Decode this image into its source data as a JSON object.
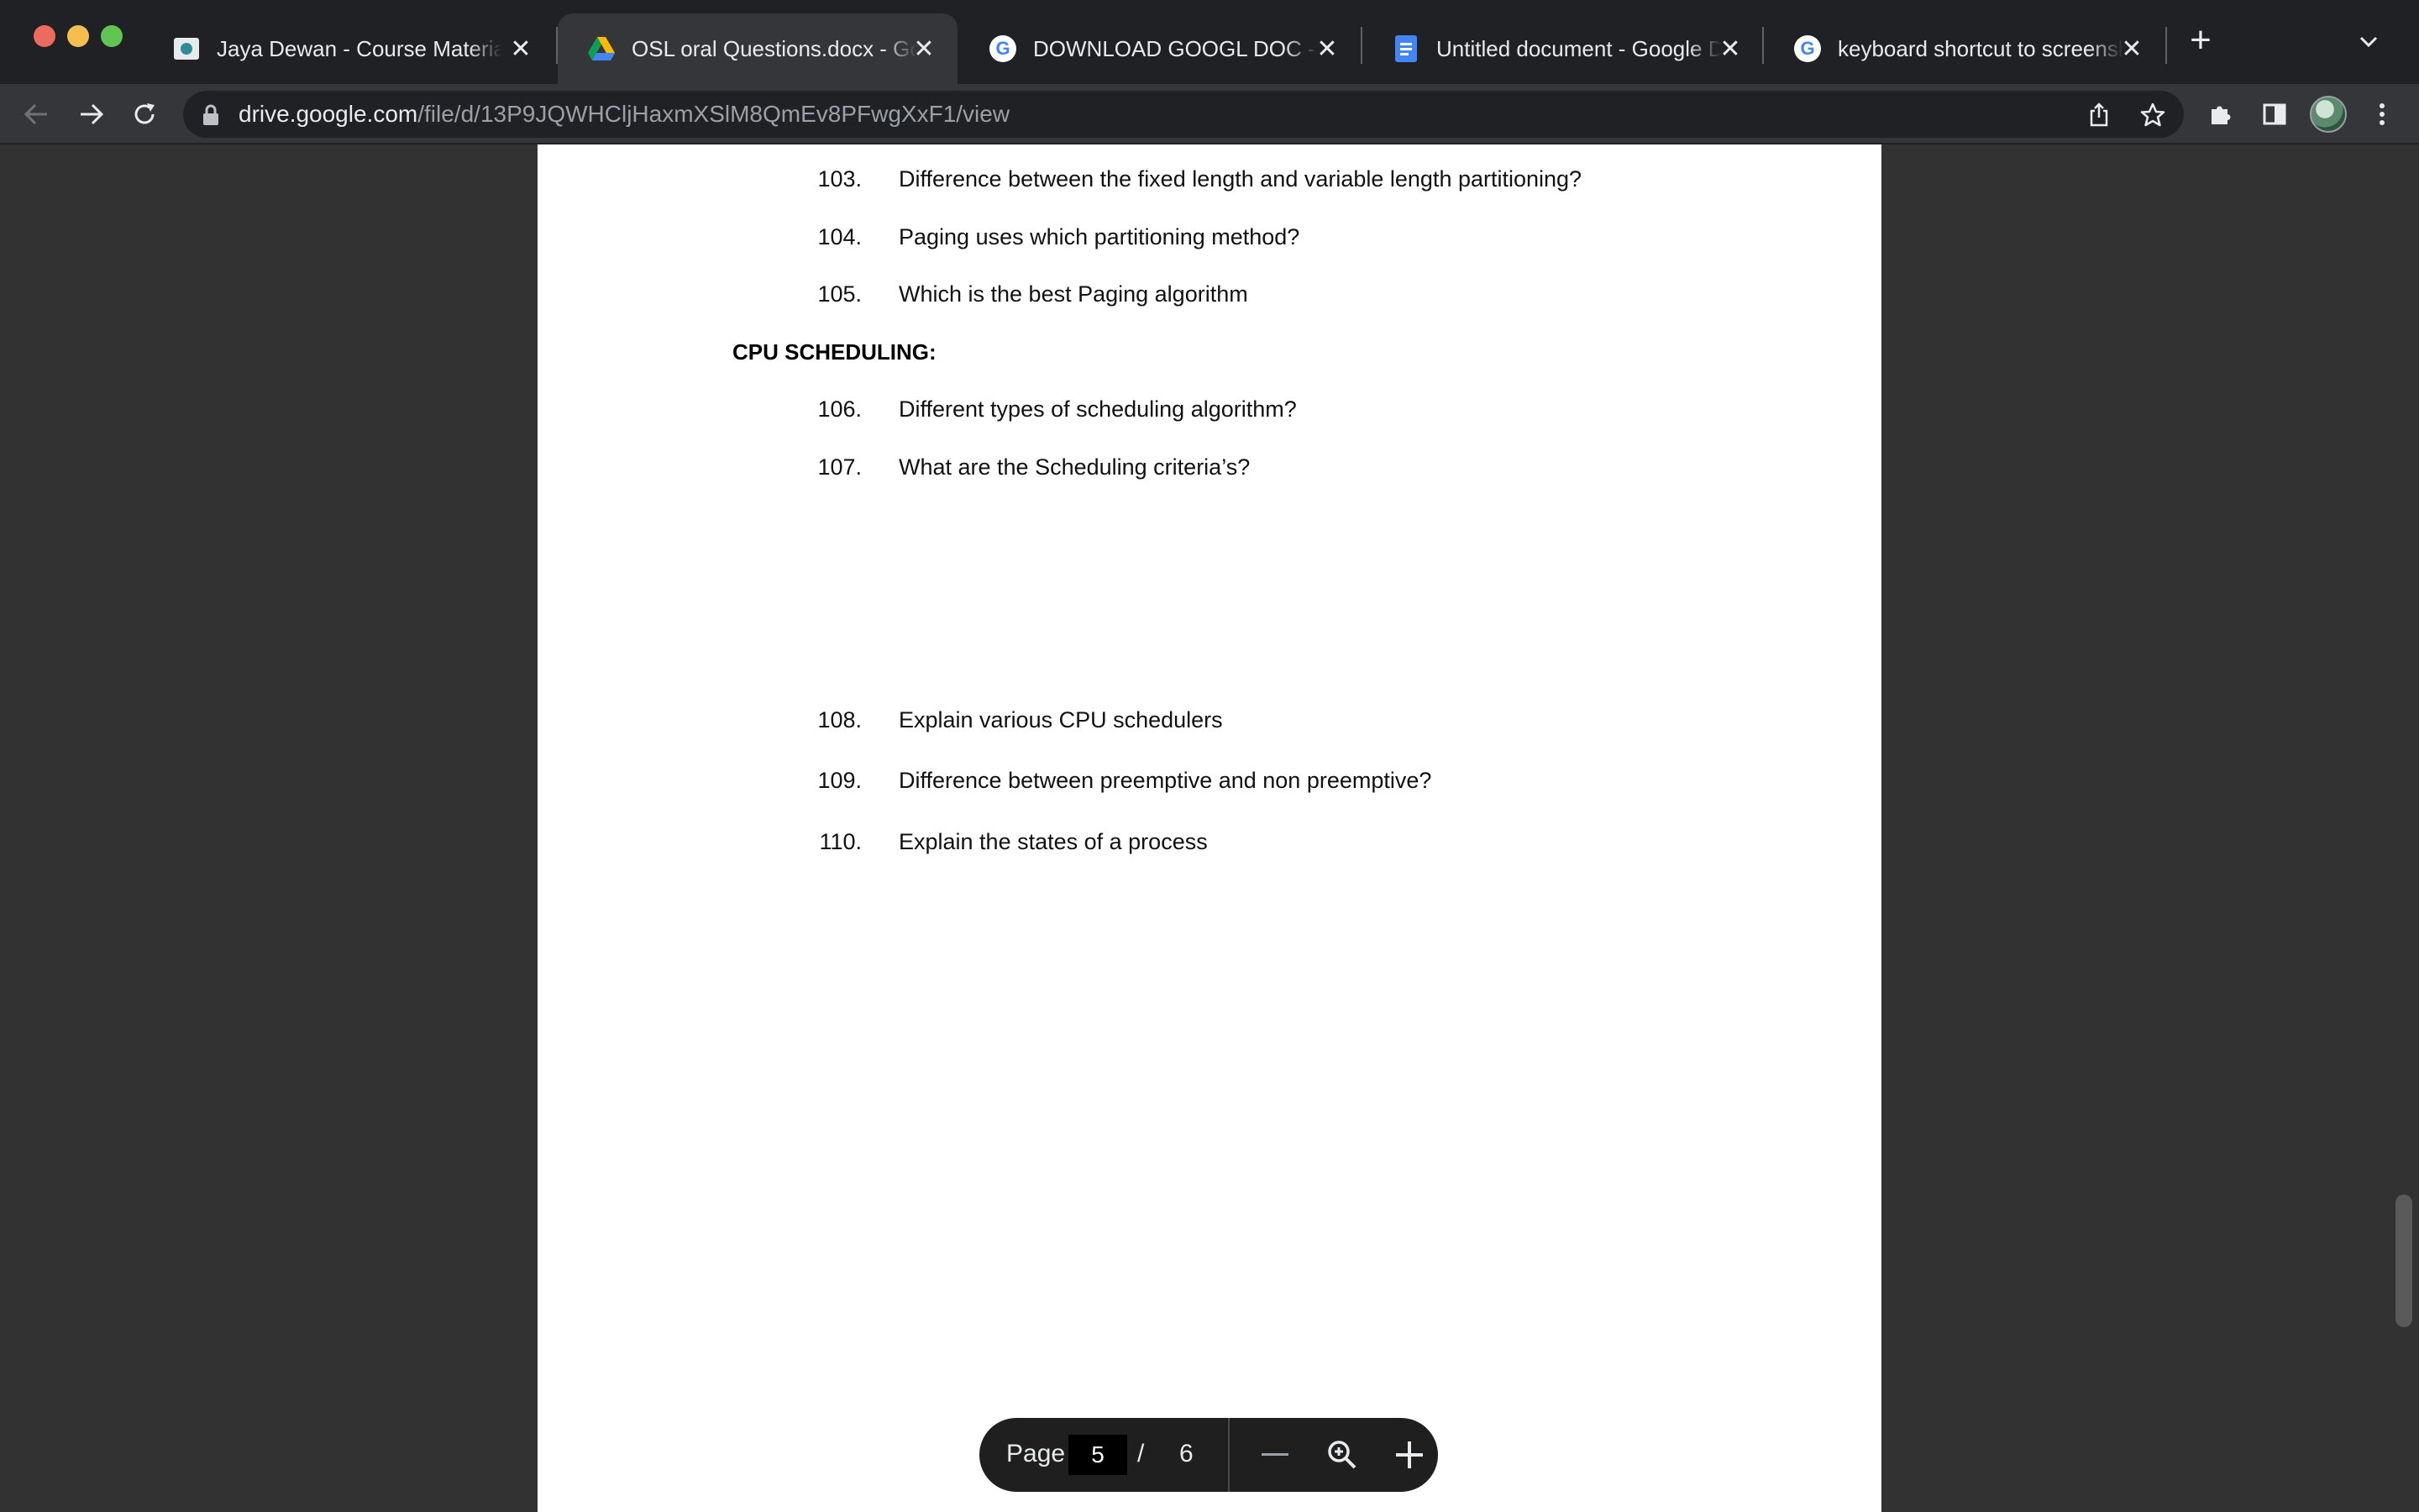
{
  "tabs": [
    {
      "title": "Jaya Dewan - Course Material",
      "icon": "school-icon"
    },
    {
      "title": "OSL oral Questions.docx - Google Drive",
      "icon": "google-drive-icon"
    },
    {
      "title": "DOWNLOAD GOOGL DOC - Google Search",
      "icon": "google-icon"
    },
    {
      "title": "Untitled document - Google Docs",
      "icon": "google-docs-icon"
    },
    {
      "title": "keyboard shortcut to screenshot",
      "icon": "google-icon"
    }
  ],
  "address_bar": {
    "host": "drive.google.com",
    "path": "/file/d/13P9JQWHCljHaxmXSlM8QmEv8PFwgXxF1/view"
  },
  "document": {
    "page_a": {
      "questions_before": [
        {
          "num": "103.",
          "text": "Difference between the fixed length and variable length partitioning?"
        },
        {
          "num": "104.",
          "text": "Paging uses which partitioning method?"
        },
        {
          "num": "105.",
          "text": "Which is the best Paging algorithm"
        }
      ],
      "section_heading": "CPU SCHEDULING:",
      "questions_after": [
        {
          "num": "106.",
          "text": "Different types of scheduling algorithm?"
        },
        {
          "num": "107.",
          "text": "What are the Scheduling criteria’s?"
        }
      ]
    },
    "page_b": {
      "questions": [
        {
          "num": "108.",
          "text": "Explain various CPU schedulers"
        },
        {
          "num": "109.",
          "text": "Difference between preemptive and non preemptive?"
        },
        {
          "num": "110.",
          "text": "Explain the states of a process"
        }
      ]
    }
  },
  "page_controls": {
    "label": "Page",
    "current": "5",
    "separator": "/",
    "total": "6"
  }
}
